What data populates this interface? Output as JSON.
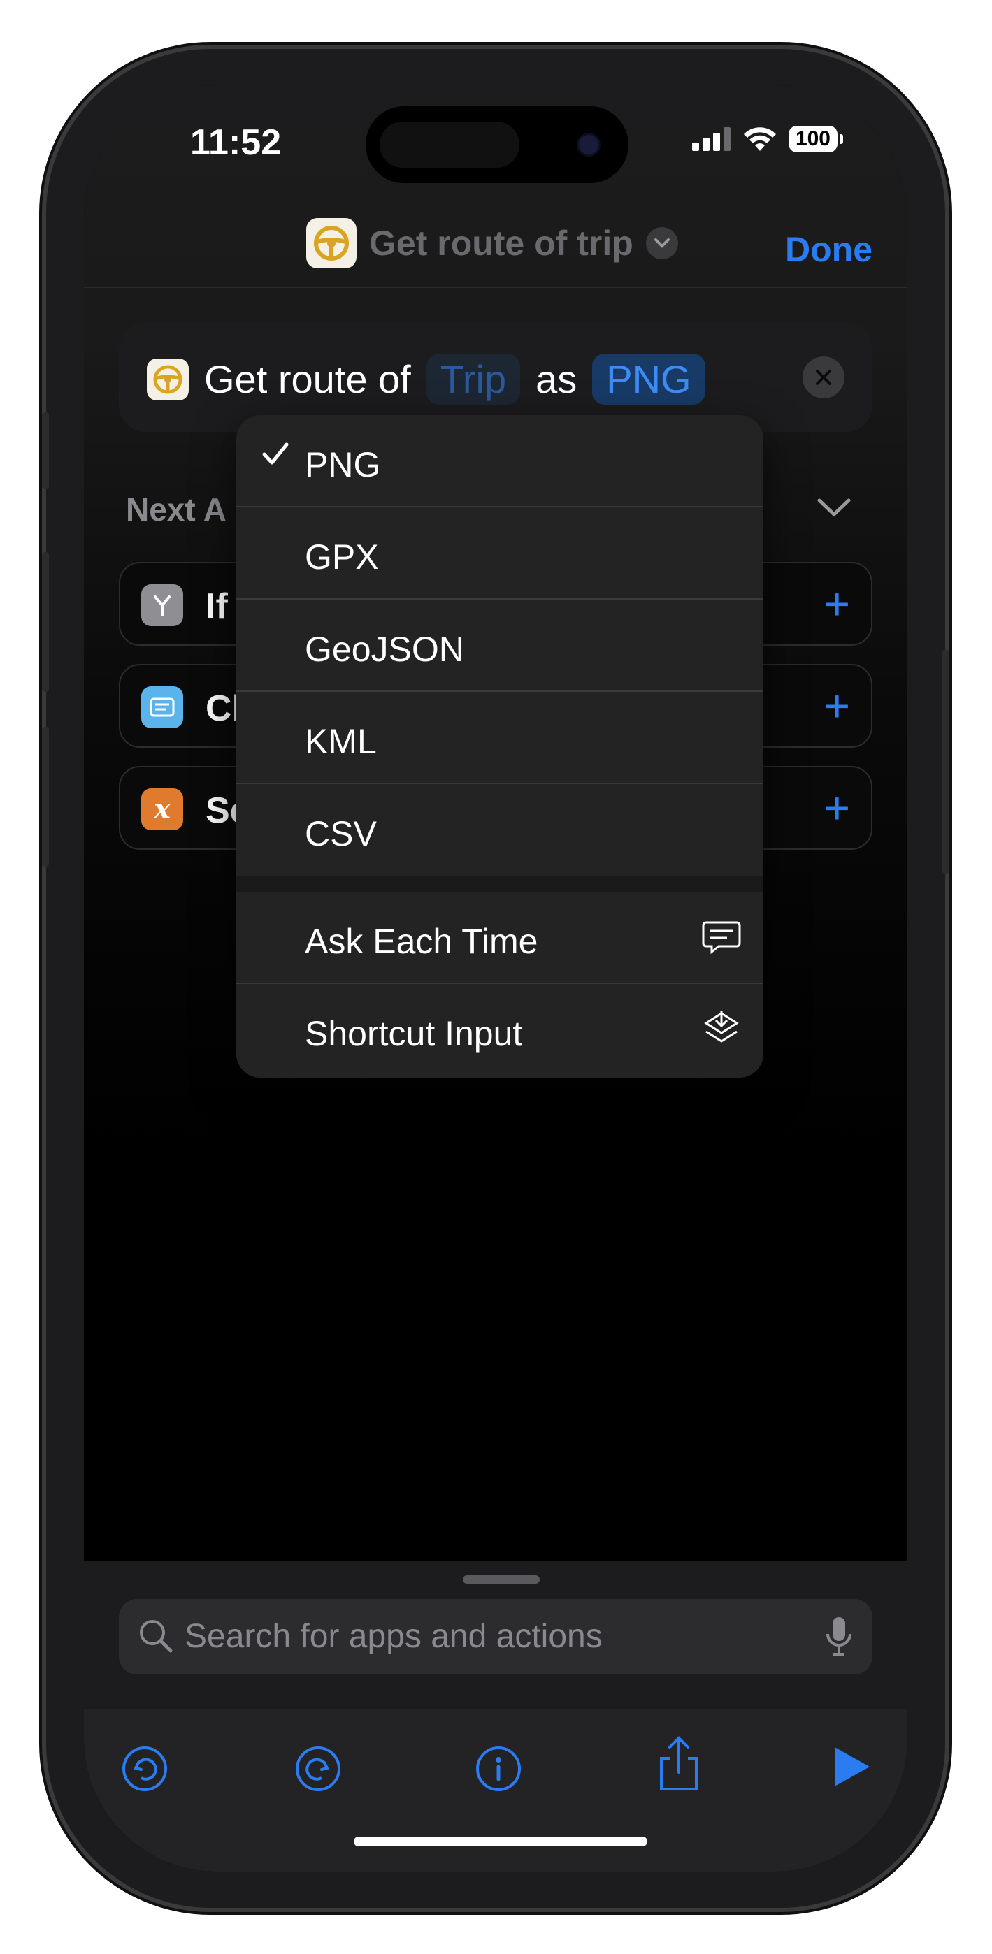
{
  "status_bar": {
    "time": "11:52",
    "battery": "100"
  },
  "nav": {
    "title": "Get route of trip",
    "done_label": "Done"
  },
  "action": {
    "prefix": "Get route of",
    "trip_token": "Trip",
    "connector": "as",
    "format_token": "PNG"
  },
  "next_actions": {
    "header": "Next A",
    "items": [
      {
        "label": "If",
        "icon": "branch-icon",
        "color": "#8e8e93"
      },
      {
        "label": "Cl",
        "icon": "clipboard-icon",
        "color": "#5ab3ea"
      },
      {
        "label": "Se",
        "icon": "variable-icon",
        "color": "#e07a2c"
      }
    ]
  },
  "menu": {
    "items": [
      {
        "label": "PNG",
        "checked": true
      },
      {
        "label": "GPX"
      },
      {
        "label": "GeoJSON"
      },
      {
        "label": "KML"
      },
      {
        "label": "CSV"
      }
    ],
    "extra": [
      {
        "label": "Ask Each Time",
        "icon": "speech-bubble-icon"
      },
      {
        "label": "Shortcut Input",
        "icon": "shortcut-input-icon"
      }
    ]
  },
  "bottom": {
    "search_placeholder": "Search for apps and actions"
  },
  "colors": {
    "accent": "#2b7cf1",
    "background": "#000000"
  }
}
